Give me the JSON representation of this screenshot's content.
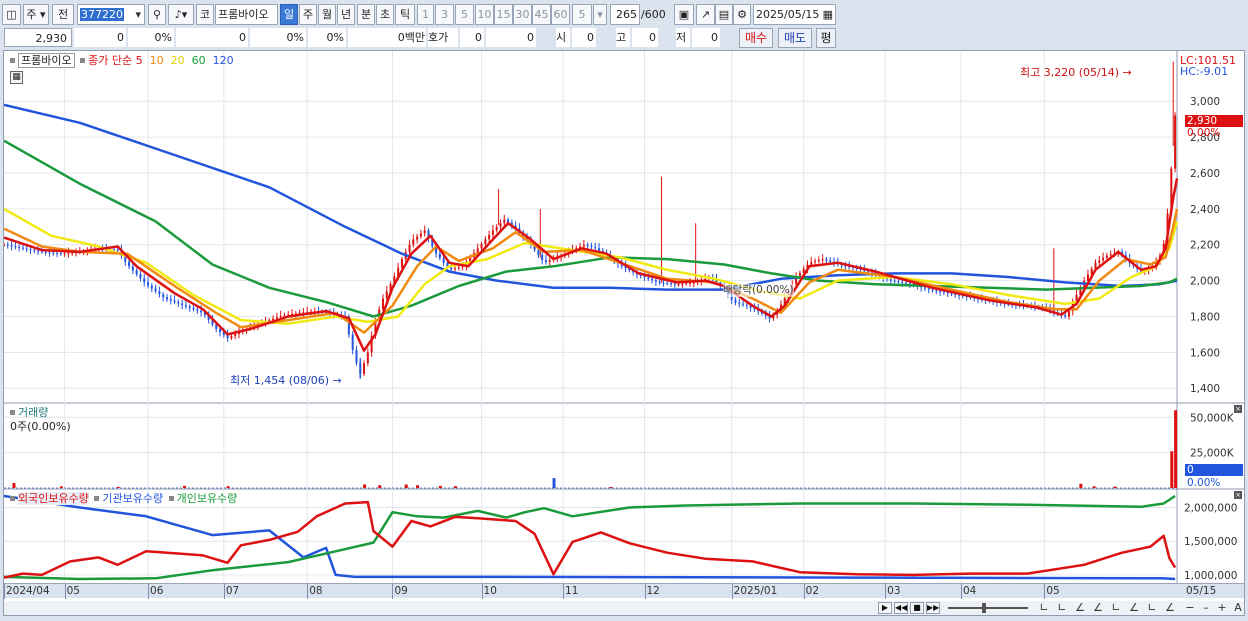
{
  "toolbar": {
    "market": "주",
    "prev": "전",
    "code": "377220",
    "code_btn": "코",
    "name": "프롬바이오",
    "periods": [
      "일",
      "주",
      "월",
      "년",
      "분",
      "초",
      "틱"
    ],
    "multipliers": [
      "1",
      "3",
      "5",
      "10",
      "15",
      "30",
      "45",
      "60"
    ],
    "custom_mult": "5",
    "count": "265",
    "count_max": "/600",
    "date": "2025/05/15"
  },
  "inforow": {
    "price": "2,930",
    "change": "0",
    "change_pct": "0%",
    "volume": "0",
    "volume_pct": "0%",
    "turnover_pct": "0%",
    "amount": "0백만",
    "bid_label": "호가",
    "bid1": "0",
    "bid2": "0",
    "open_label": "시",
    "open": "0",
    "high_label": "고",
    "high": "0",
    "low_label": "저",
    "low": "0",
    "buy": "매수",
    "sell": "매도",
    "avg": "평"
  },
  "price_panel": {
    "title": "프롬바이오",
    "ma_label": "종가 단순",
    "ma_periods": [
      "5",
      "10",
      "20",
      "60",
      "120"
    ],
    "ma_colors": [
      "#dd1111",
      "#f08a10",
      "#f0ea10",
      "#1a9a3a",
      "#2255dd"
    ],
    "lc": "LC:101.51",
    "hc": "HC:-9.01",
    "high_annot": "최고 3,220 (05/14)",
    "low_annot": "최저 1,454 (08/06)",
    "dividend_annot": "배당락(0.00%)",
    "current_price": "2,930",
    "current_pct": "0.00%"
  },
  "volume_panel": {
    "title": "거래량",
    "value": "0주(0.00%)",
    "current": "0",
    "current_pct": "0.00%"
  },
  "holdings_panel": {
    "series": [
      "외국인보유수량",
      "기관보유수량",
      "개인보유수량"
    ],
    "series_colors": [
      "#dd1111",
      "#2255dd",
      "#1a9a3a"
    ]
  },
  "chart_data": {
    "type": "line",
    "price_ticks": [
      "3,000",
      "2,800",
      "2,600",
      "2,400",
      "2,200",
      "2,000",
      "1,800",
      "1,600",
      "1,400"
    ],
    "price_tick_values": [
      3000,
      2800,
      2600,
      2400,
      2200,
      2000,
      1800,
      1600,
      1400
    ],
    "price_ylim": [
      1340,
      3280
    ],
    "volume_ticks": [
      "50,000K",
      "25,000K"
    ],
    "volume_tick_values": [
      50000,
      25000
    ],
    "volume_ylim": [
      0,
      58000
    ],
    "holdings_ticks": [
      "2,000,000",
      "1,500,000",
      "1,000,000"
    ],
    "holdings_tick_values": [
      2000000,
      1500000,
      1000000
    ],
    "holdings_ylim": [
      880000,
      2230000
    ],
    "x_labels": [
      "2024/04",
      "05",
      "06",
      "07",
      "08",
      "09",
      "10",
      "11",
      "12",
      "2025/01",
      "02",
      "03",
      "04",
      "05",
      "05/15"
    ],
    "close_series": [
      [
        0,
        2200
      ],
      [
        10,
        2180
      ],
      [
        20,
        2160
      ],
      [
        30,
        2150
      ],
      [
        40,
        2160
      ],
      [
        50,
        2180
      ],
      [
        60,
        2170
      ],
      [
        65,
        2090
      ],
      [
        75,
        1980
      ],
      [
        85,
        1900
      ],
      [
        95,
        1860
      ],
      [
        105,
        1820
      ],
      [
        112,
        1730
      ],
      [
        118,
        1680
      ],
      [
        125,
        1720
      ],
      [
        135,
        1760
      ],
      [
        145,
        1800
      ],
      [
        155,
        1820
      ],
      [
        165,
        1830
      ],
      [
        175,
        1810
      ],
      [
        180,
        1800
      ],
      [
        183,
        1650
      ],
      [
        186,
        1540
      ],
      [
        188,
        1480
      ],
      [
        192,
        1600
      ],
      [
        196,
        1780
      ],
      [
        200,
        1900
      ],
      [
        205,
        2000
      ],
      [
        210,
        2120
      ],
      [
        215,
        2220
      ],
      [
        222,
        2280
      ],
      [
        228,
        2150
      ],
      [
        235,
        2060
      ],
      [
        242,
        2080
      ],
      [
        250,
        2180
      ],
      [
        258,
        2280
      ],
      [
        264,
        2340
      ],
      [
        270,
        2290
      ],
      [
        278,
        2200
      ],
      [
        285,
        2100
      ],
      [
        292,
        2130
      ],
      [
        300,
        2170
      ],
      [
        306,
        2200
      ],
      [
        312,
        2180
      ],
      [
        318,
        2140
      ],
      [
        326,
        2080
      ],
      [
        335,
        2030
      ],
      [
        345,
        1990
      ],
      [
        355,
        1980
      ],
      [
        365,
        1990
      ],
      [
        373,
        2020
      ],
      [
        380,
        1950
      ],
      [
        385,
        1880
      ],
      [
        392,
        1860
      ],
      [
        398,
        1830
      ],
      [
        404,
        1790
      ],
      [
        408,
        1830
      ],
      [
        413,
        1920
      ],
      [
        418,
        2020
      ],
      [
        425,
        2100
      ],
      [
        432,
        2120
      ],
      [
        440,
        2090
      ],
      [
        448,
        2070
      ],
      [
        458,
        2040
      ],
      [
        468,
        2000
      ],
      [
        478,
        1980
      ],
      [
        488,
        1950
      ],
      [
        498,
        1930
      ],
      [
        508,
        1910
      ],
      [
        518,
        1890
      ],
      [
        528,
        1870
      ],
      [
        538,
        1860
      ],
      [
        548,
        1850
      ],
      [
        555,
        1820
      ],
      [
        560,
        1800
      ],
      [
        562,
        1830
      ],
      [
        565,
        1900
      ],
      [
        570,
        2000
      ],
      [
        576,
        2100
      ],
      [
        582,
        2140
      ],
      [
        588,
        2160
      ],
      [
        594,
        2100
      ],
      [
        600,
        2050
      ],
      [
        605,
        2070
      ],
      [
        608,
        2100
      ],
      [
        611,
        2160
      ],
      [
        613,
        2250
      ],
      [
        615,
        2500
      ],
      [
        617,
        2750
      ],
      [
        618,
        2920
      ],
      [
        619,
        2930
      ]
    ],
    "ma5": [
      [
        0,
        2240
      ],
      [
        20,
        2170
      ],
      [
        40,
        2160
      ],
      [
        60,
        2190
      ],
      [
        70,
        2080
      ],
      [
        90,
        1930
      ],
      [
        105,
        1840
      ],
      [
        118,
        1700
      ],
      [
        130,
        1730
      ],
      [
        150,
        1800
      ],
      [
        170,
        1830
      ],
      [
        182,
        1790
      ],
      [
        190,
        1610
      ],
      [
        196,
        1700
      ],
      [
        205,
        1960
      ],
      [
        215,
        2150
      ],
      [
        225,
        2250
      ],
      [
        235,
        2100
      ],
      [
        245,
        2080
      ],
      [
        258,
        2230
      ],
      [
        266,
        2320
      ],
      [
        278,
        2230
      ],
      [
        290,
        2120
      ],
      [
        305,
        2180
      ],
      [
        318,
        2150
      ],
      [
        335,
        2040
      ],
      [
        355,
        1990
      ],
      [
        370,
        2000
      ],
      [
        380,
        1970
      ],
      [
        395,
        1860
      ],
      [
        405,
        1800
      ],
      [
        412,
        1860
      ],
      [
        425,
        2080
      ],
      [
        440,
        2100
      ],
      [
        460,
        2050
      ],
      [
        490,
        1960
      ],
      [
        520,
        1890
      ],
      [
        545,
        1850
      ],
      [
        558,
        1810
      ],
      [
        566,
        1870
      ],
      [
        576,
        2060
      ],
      [
        588,
        2160
      ],
      [
        600,
        2060
      ],
      [
        608,
        2080
      ],
      [
        613,
        2180
      ],
      [
        617,
        2460
      ],
      [
        619,
        2570
      ]
    ],
    "ma10": [
      [
        0,
        2290
      ],
      [
        20,
        2190
      ],
      [
        40,
        2160
      ],
      [
        65,
        2150
      ],
      [
        90,
        1970
      ],
      [
        112,
        1820
      ],
      [
        125,
        1740
      ],
      [
        150,
        1780
      ],
      [
        175,
        1820
      ],
      [
        190,
        1710
      ],
      [
        205,
        1860
      ],
      [
        218,
        2080
      ],
      [
        228,
        2190
      ],
      [
        240,
        2110
      ],
      [
        258,
        2180
      ],
      [
        270,
        2270
      ],
      [
        285,
        2160
      ],
      [
        305,
        2170
      ],
      [
        325,
        2100
      ],
      [
        350,
        2010
      ],
      [
        375,
        1990
      ],
      [
        395,
        1900
      ],
      [
        410,
        1820
      ],
      [
        425,
        1990
      ],
      [
        440,
        2060
      ],
      [
        470,
        2020
      ],
      [
        500,
        1950
      ],
      [
        530,
        1880
      ],
      [
        555,
        1840
      ],
      [
        566,
        1840
      ],
      [
        578,
        2000
      ],
      [
        592,
        2120
      ],
      [
        605,
        2090
      ],
      [
        613,
        2130
      ],
      [
        617,
        2300
      ],
      [
        619,
        2400
      ]
    ],
    "ma20": [
      [
        0,
        2400
      ],
      [
        25,
        2250
      ],
      [
        50,
        2190
      ],
      [
        75,
        2100
      ],
      [
        100,
        1920
      ],
      [
        125,
        1780
      ],
      [
        150,
        1760
      ],
      [
        175,
        1800
      ],
      [
        192,
        1770
      ],
      [
        208,
        1800
      ],
      [
        222,
        1980
      ],
      [
        235,
        2080
      ],
      [
        255,
        2120
      ],
      [
        275,
        2210
      ],
      [
        300,
        2170
      ],
      [
        325,
        2130
      ],
      [
        350,
        2060
      ],
      [
        375,
        2010
      ],
      [
        400,
        1940
      ],
      [
        420,
        1900
      ],
      [
        440,
        2000
      ],
      [
        470,
        2020
      ],
      [
        500,
        1980
      ],
      [
        530,
        1920
      ],
      [
        560,
        1870
      ],
      [
        578,
        1900
      ],
      [
        595,
        2020
      ],
      [
        608,
        2080
      ],
      [
        615,
        2180
      ],
      [
        619,
        2330
      ]
    ],
    "ma60": [
      [
        0,
        2780
      ],
      [
        40,
        2540
      ],
      [
        80,
        2330
      ],
      [
        110,
        2090
      ],
      [
        140,
        1960
      ],
      [
        170,
        1880
      ],
      [
        195,
        1800
      ],
      [
        215,
        1860
      ],
      [
        240,
        1970
      ],
      [
        265,
        2050
      ],
      [
        290,
        2080
      ],
      [
        320,
        2130
      ],
      [
        350,
        2120
      ],
      [
        380,
        2090
      ],
      [
        405,
        2040
      ],
      [
        430,
        2000
      ],
      [
        460,
        1980
      ],
      [
        490,
        1970
      ],
      [
        520,
        1960
      ],
      [
        550,
        1950
      ],
      [
        575,
        1960
      ],
      [
        600,
        1970
      ],
      [
        615,
        1990
      ],
      [
        619,
        2010
      ]
    ],
    "ma120": [
      [
        0,
        2980
      ],
      [
        40,
        2880
      ],
      [
        90,
        2700
      ],
      [
        140,
        2520
      ],
      [
        180,
        2300
      ],
      [
        210,
        2150
      ],
      [
        235,
        2050
      ],
      [
        260,
        2000
      ],
      [
        290,
        1960
      ],
      [
        320,
        1960
      ],
      [
        350,
        1950
      ],
      [
        380,
        1950
      ],
      [
        410,
        2010
      ],
      [
        440,
        2030
      ],
      [
        470,
        2040
      ],
      [
        500,
        2040
      ],
      [
        530,
        2020
      ],
      [
        560,
        1990
      ],
      [
        590,
        1970
      ],
      [
        610,
        1980
      ],
      [
        619,
        2000
      ]
    ],
    "volume_bars": [
      [
        5,
        3500
      ],
      [
        30,
        1200
      ],
      [
        60,
        800
      ],
      [
        95,
        1500
      ],
      [
        118,
        1300
      ],
      [
        190,
        2500
      ],
      [
        198,
        2000
      ],
      [
        212,
        2500
      ],
      [
        218,
        2000
      ],
      [
        230,
        1500
      ],
      [
        238,
        1300
      ],
      [
        290,
        7000
      ],
      [
        320,
        700
      ],
      [
        568,
        3000
      ],
      [
        575,
        1200
      ],
      [
        586,
        1000
      ],
      [
        616,
        26000
      ],
      [
        618,
        55000
      ]
    ],
    "foreign": [
      [
        0,
        960000
      ],
      [
        10,
        1020000
      ],
      [
        20,
        1000000
      ],
      [
        35,
        1200000
      ],
      [
        50,
        1260000
      ],
      [
        60,
        1150000
      ],
      [
        75,
        1350000
      ],
      [
        90,
        1320000
      ],
      [
        105,
        1290000
      ],
      [
        118,
        1180000
      ],
      [
        125,
        1440000
      ],
      [
        140,
        1520000
      ],
      [
        155,
        1640000
      ],
      [
        165,
        1870000
      ],
      [
        180,
        2060000
      ],
      [
        192,
        2080000
      ],
      [
        195,
        1650000
      ],
      [
        205,
        1420000
      ],
      [
        215,
        1800000
      ],
      [
        225,
        1720000
      ],
      [
        238,
        1860000
      ],
      [
        250,
        1840000
      ],
      [
        270,
        1800000
      ],
      [
        280,
        1610000
      ],
      [
        290,
        1010000
      ],
      [
        300,
        1490000
      ],
      [
        315,
        1630000
      ],
      [
        330,
        1470000
      ],
      [
        350,
        1330000
      ],
      [
        370,
        1240000
      ],
      [
        395,
        1200000
      ],
      [
        420,
        1040000
      ],
      [
        450,
        1010000
      ],
      [
        480,
        1000000
      ],
      [
        510,
        1020000
      ],
      [
        540,
        1020000
      ],
      [
        570,
        1150000
      ],
      [
        590,
        1330000
      ],
      [
        605,
        1420000
      ],
      [
        612,
        1580000
      ],
      [
        615,
        1250000
      ],
      [
        618,
        1110000
      ]
    ],
    "institution": [
      [
        0,
        2170000
      ],
      [
        40,
        2000000
      ],
      [
        75,
        1870000
      ],
      [
        110,
        1590000
      ],
      [
        140,
        1660000
      ],
      [
        158,
        1260000
      ],
      [
        170,
        1400000
      ],
      [
        175,
        1000000
      ],
      [
        185,
        970000
      ],
      [
        260,
        970000
      ],
      [
        450,
        960000
      ],
      [
        611,
        950000
      ],
      [
        618,
        940000
      ]
    ],
    "individual": [
      [
        0,
        970000
      ],
      [
        40,
        940000
      ],
      [
        80,
        950000
      ],
      [
        110,
        1070000
      ],
      [
        150,
        1190000
      ],
      [
        175,
        1350000
      ],
      [
        195,
        1480000
      ],
      [
        205,
        1930000
      ],
      [
        218,
        1870000
      ],
      [
        232,
        1850000
      ],
      [
        250,
        1950000
      ],
      [
        265,
        1850000
      ],
      [
        275,
        1930000
      ],
      [
        285,
        1990000
      ],
      [
        300,
        1870000
      ],
      [
        330,
        2000000
      ],
      [
        360,
        2030000
      ],
      [
        420,
        2060000
      ],
      [
        480,
        2060000
      ],
      [
        540,
        2040000
      ],
      [
        600,
        2010000
      ],
      [
        612,
        2060000
      ],
      [
        618,
        2170000
      ]
    ]
  }
}
